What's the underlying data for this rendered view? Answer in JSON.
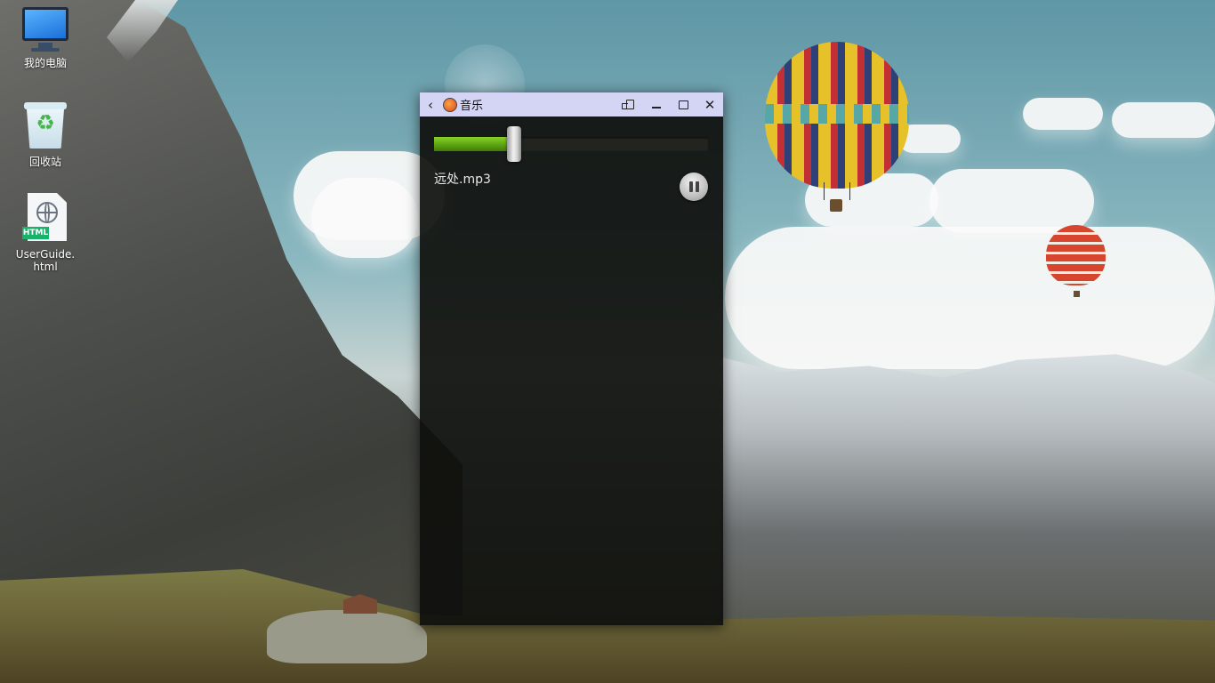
{
  "desktop": {
    "icons": [
      {
        "label": "我的电脑",
        "icon": "computer-icon"
      },
      {
        "label": "回收站",
        "icon": "recycle-bin-icon"
      },
      {
        "label": "UserGuide.html",
        "icon": "html-file-icon",
        "badge": "HTML"
      }
    ]
  },
  "window": {
    "title": "音乐",
    "app_icon": "music-app-icon",
    "controls": [
      "back-icon",
      "rotate-icon",
      "minimize-icon",
      "maximize-icon",
      "close-icon"
    ]
  },
  "player": {
    "track_name": "远处.mp3",
    "progress_fraction": 0.29,
    "state_button": "pause-icon",
    "accent_color": "#6ab51a"
  }
}
